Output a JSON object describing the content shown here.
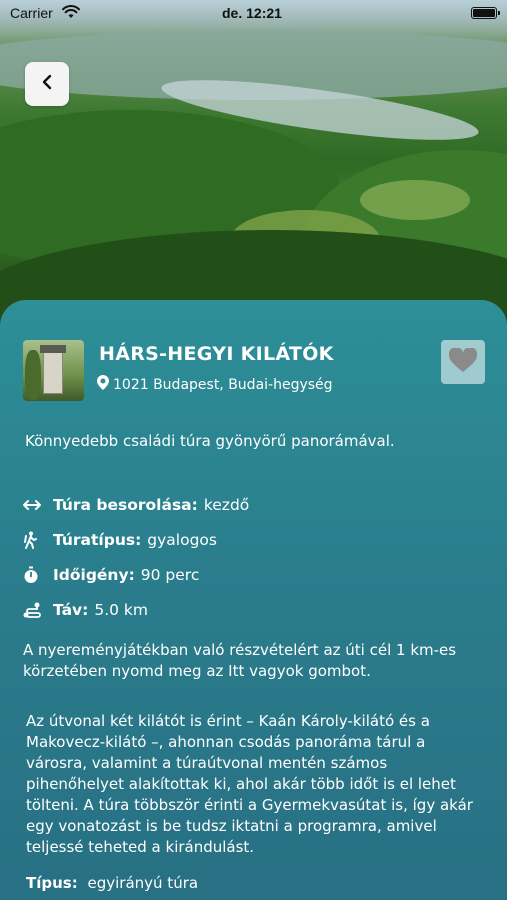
{
  "status_bar": {
    "carrier": "Carrier",
    "time": "de. 12:21"
  },
  "header": {
    "back_icon": "chevron-left-icon"
  },
  "place": {
    "title": "HÁRS-HEGYI KILÁTÓK",
    "location": "1021 Budapest, Budai-hegység",
    "favorite_icon": "heart-icon",
    "intro": "Könnyedebb családi túra gyönyörű panorámával."
  },
  "facts": [
    {
      "icon": "arrows-horizontal-icon",
      "label": "Túra besorolása:",
      "value": "kezdő"
    },
    {
      "icon": "hiker-icon",
      "label": "Túratípus:",
      "value": "gyalogos"
    },
    {
      "icon": "stopwatch-icon",
      "label": "Időigény:",
      "value": "90 perc"
    },
    {
      "icon": "route-icon",
      "label": "Táv:",
      "value": "5.0 km"
    }
  ],
  "notice": "A nyereményjátékban való részvételért az úti cél 1 km-es körzetében nyomd meg az Itt vagyok gombot.",
  "description": "Az útvonal két kilátót is érint – Kaán Károly-kilátó és a Makovecz-kilátó –, ahonnan csodás panoráma tárul a városra, valamint a túraútvonal mentén számos pihenőhelyet alakítottak ki, ahol akár több időt is el lehet tölteni. A túra többször érinti a Gyermekvasútat is, így akár egy vonatozást is be tudsz iktatni a programra, amivel teljessé teheted a kirándulást.",
  "type": {
    "label": "Típus:",
    "value": "egyirányú túra"
  },
  "colors": {
    "card_top": "#2d8f98",
    "card_bottom": "#286f83",
    "text": "#ffffff"
  }
}
